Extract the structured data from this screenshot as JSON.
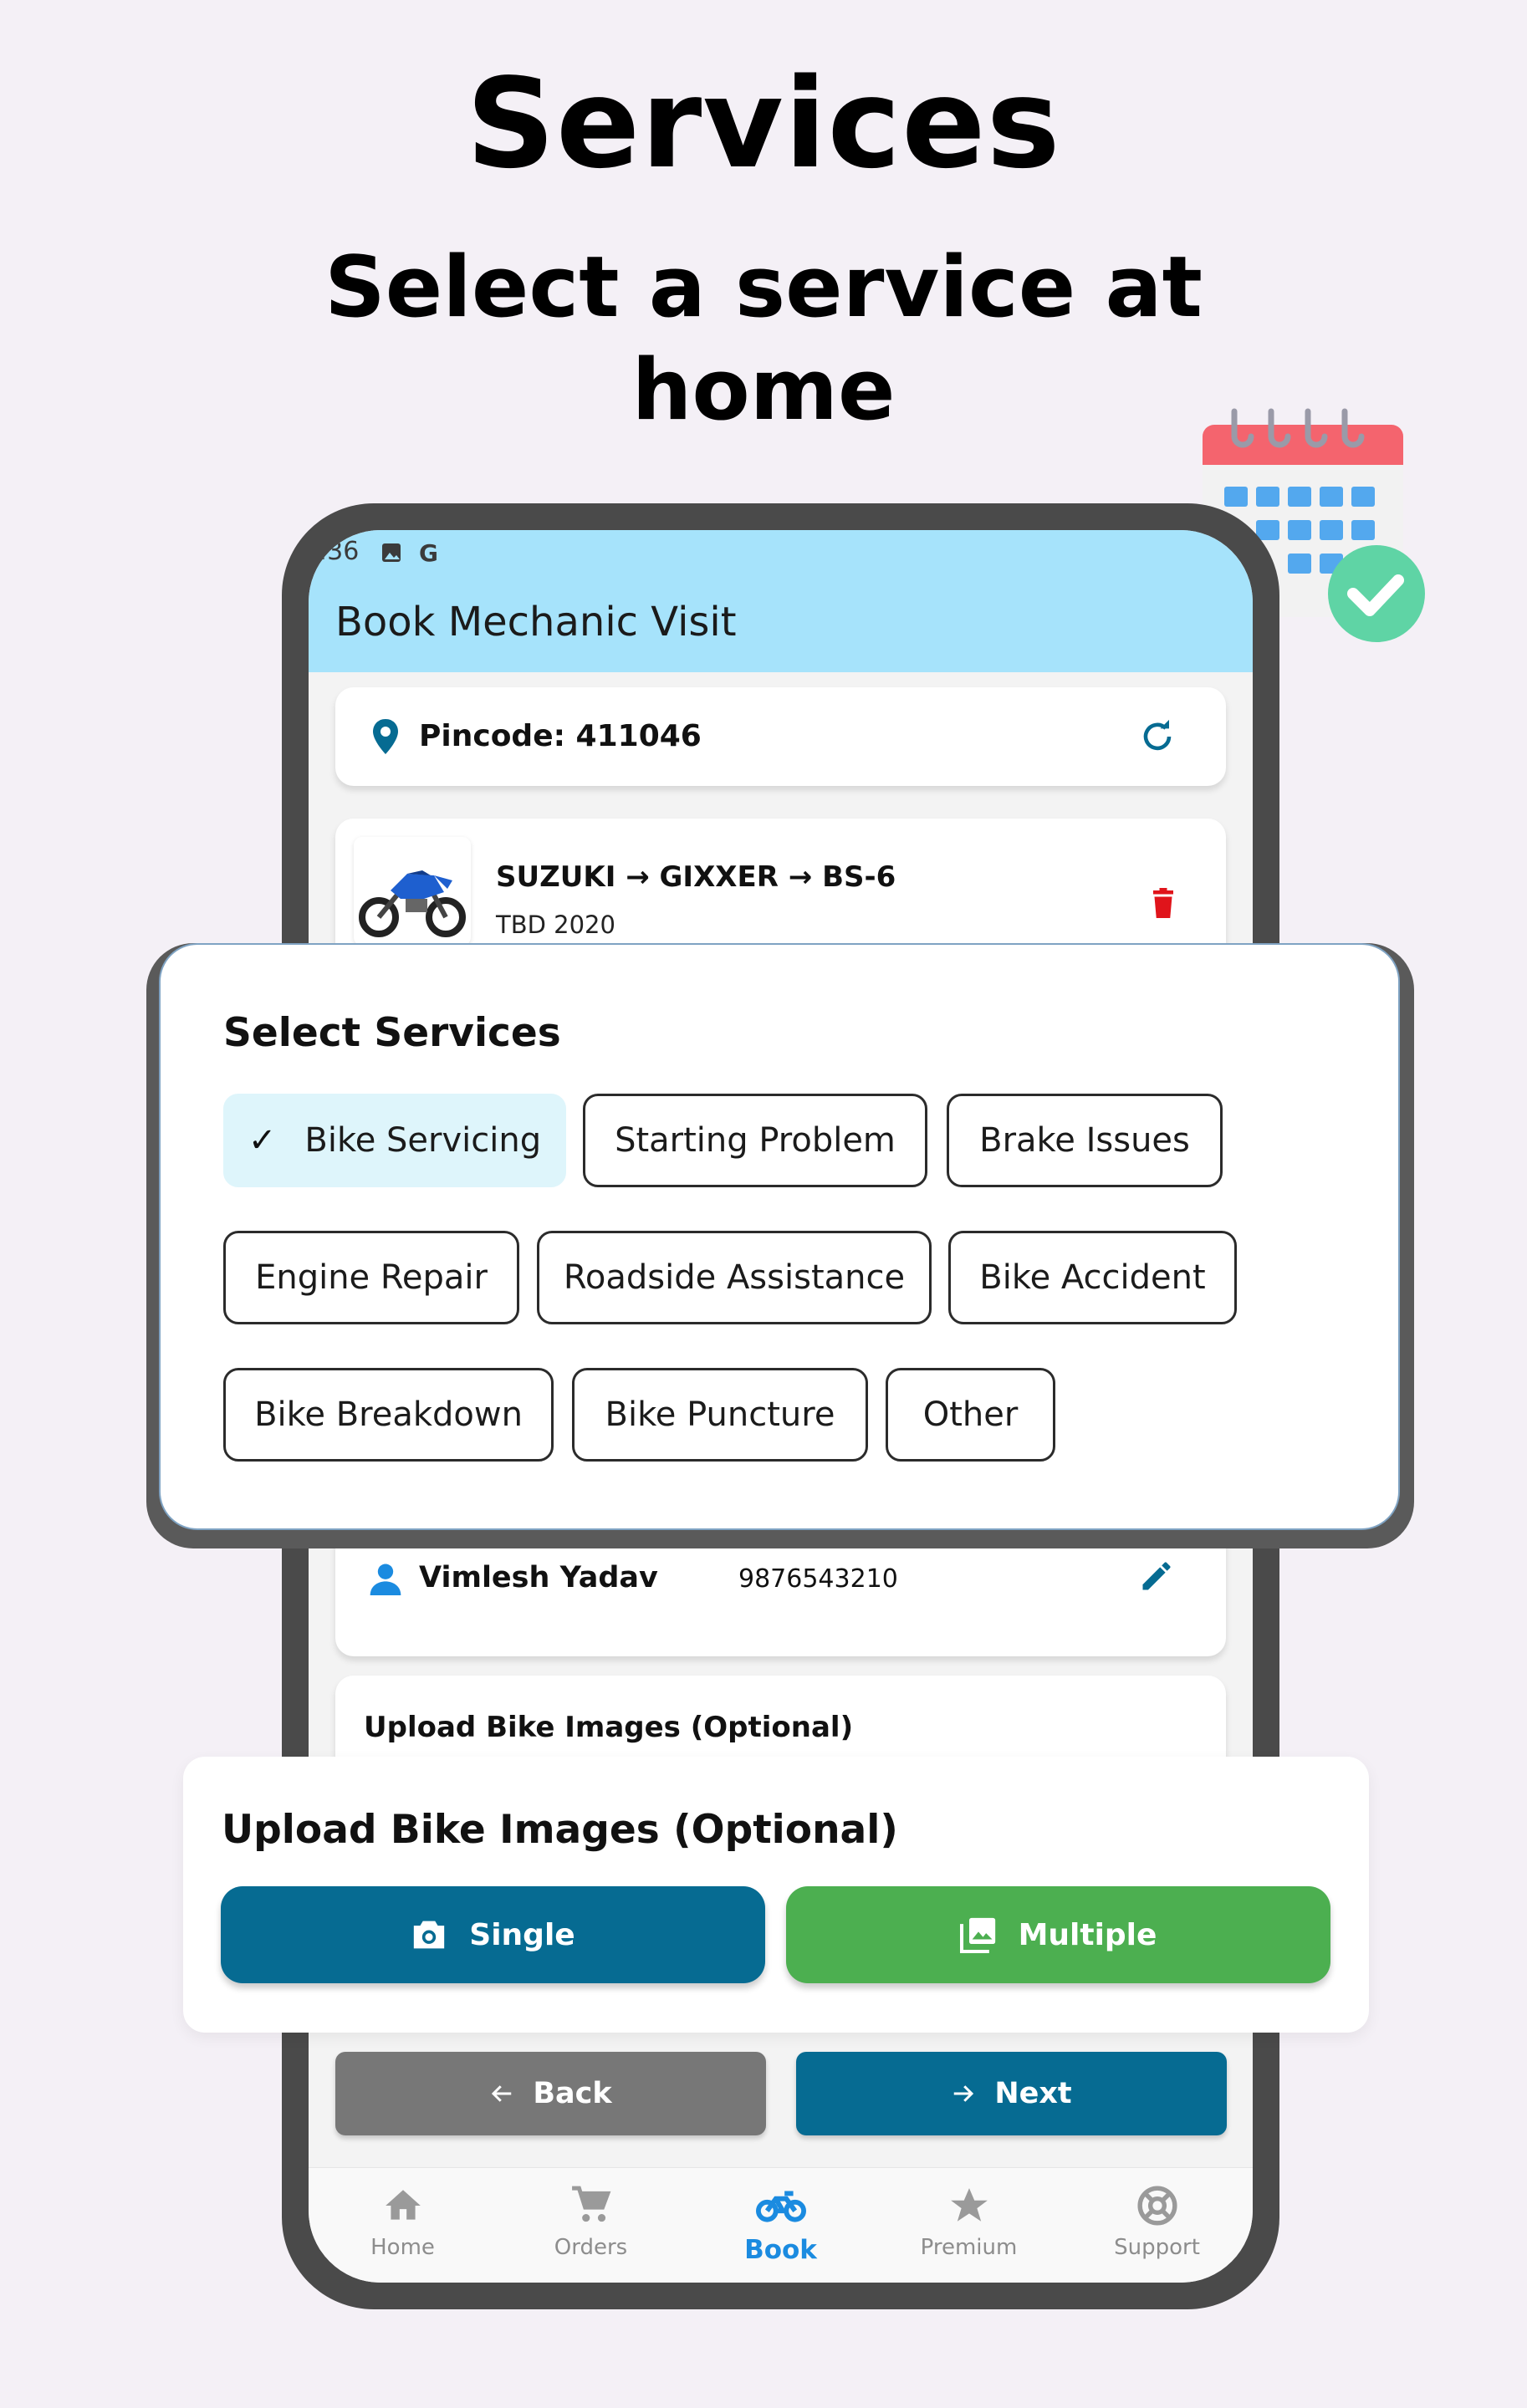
{
  "hero": {
    "title": "Services",
    "subtitle": "Select a service at home"
  },
  "status_bar": {
    "time": ":36"
  },
  "app_bar": {
    "title": "Book Mechanic Visit"
  },
  "location": {
    "pincode_label": "Pincode: 411046"
  },
  "vehicle": {
    "name": "SUZUKI → GIXXER → BS-6",
    "meta": "TBD  2020"
  },
  "services": {
    "title": "Select Services",
    "options": [
      {
        "label": "Bike Servicing",
        "selected": true
      },
      {
        "label": "Starting Problem",
        "selected": false
      },
      {
        "label": "Brake Issues",
        "selected": false
      },
      {
        "label": "Engine Repair",
        "selected": false
      },
      {
        "label": "Roadside Assistance",
        "selected": false
      },
      {
        "label": "Bike Accident",
        "selected": false
      },
      {
        "label": "Bike Breakdown",
        "selected": false
      },
      {
        "label": "Bike Puncture",
        "selected": false
      },
      {
        "label": "Other",
        "selected": false
      }
    ]
  },
  "customer": {
    "name": "Vimlesh Yadav",
    "phone": "9876543210"
  },
  "upload": {
    "title": "Upload Bike Images (Optional)",
    "single_label": "Single",
    "multiple_label": "Multiple"
  },
  "navigation": {
    "back_label": "Back",
    "next_label": "Next"
  },
  "bottom_nav": {
    "items": [
      {
        "label": "Home",
        "icon": "home-icon"
      },
      {
        "label": "Orders",
        "icon": "cart-icon"
      },
      {
        "label": "Book",
        "icon": "bike-icon",
        "active": true
      },
      {
        "label": "Premium",
        "icon": "star-icon"
      },
      {
        "label": "Support",
        "icon": "support-icon"
      }
    ]
  },
  "colors": {
    "app_bar": "#a6e3fb",
    "primary": "#066b92",
    "success": "#4caf50",
    "active_nav": "#1b8be0",
    "delete": "#e0141b",
    "selected_chip": "#def5fb"
  }
}
